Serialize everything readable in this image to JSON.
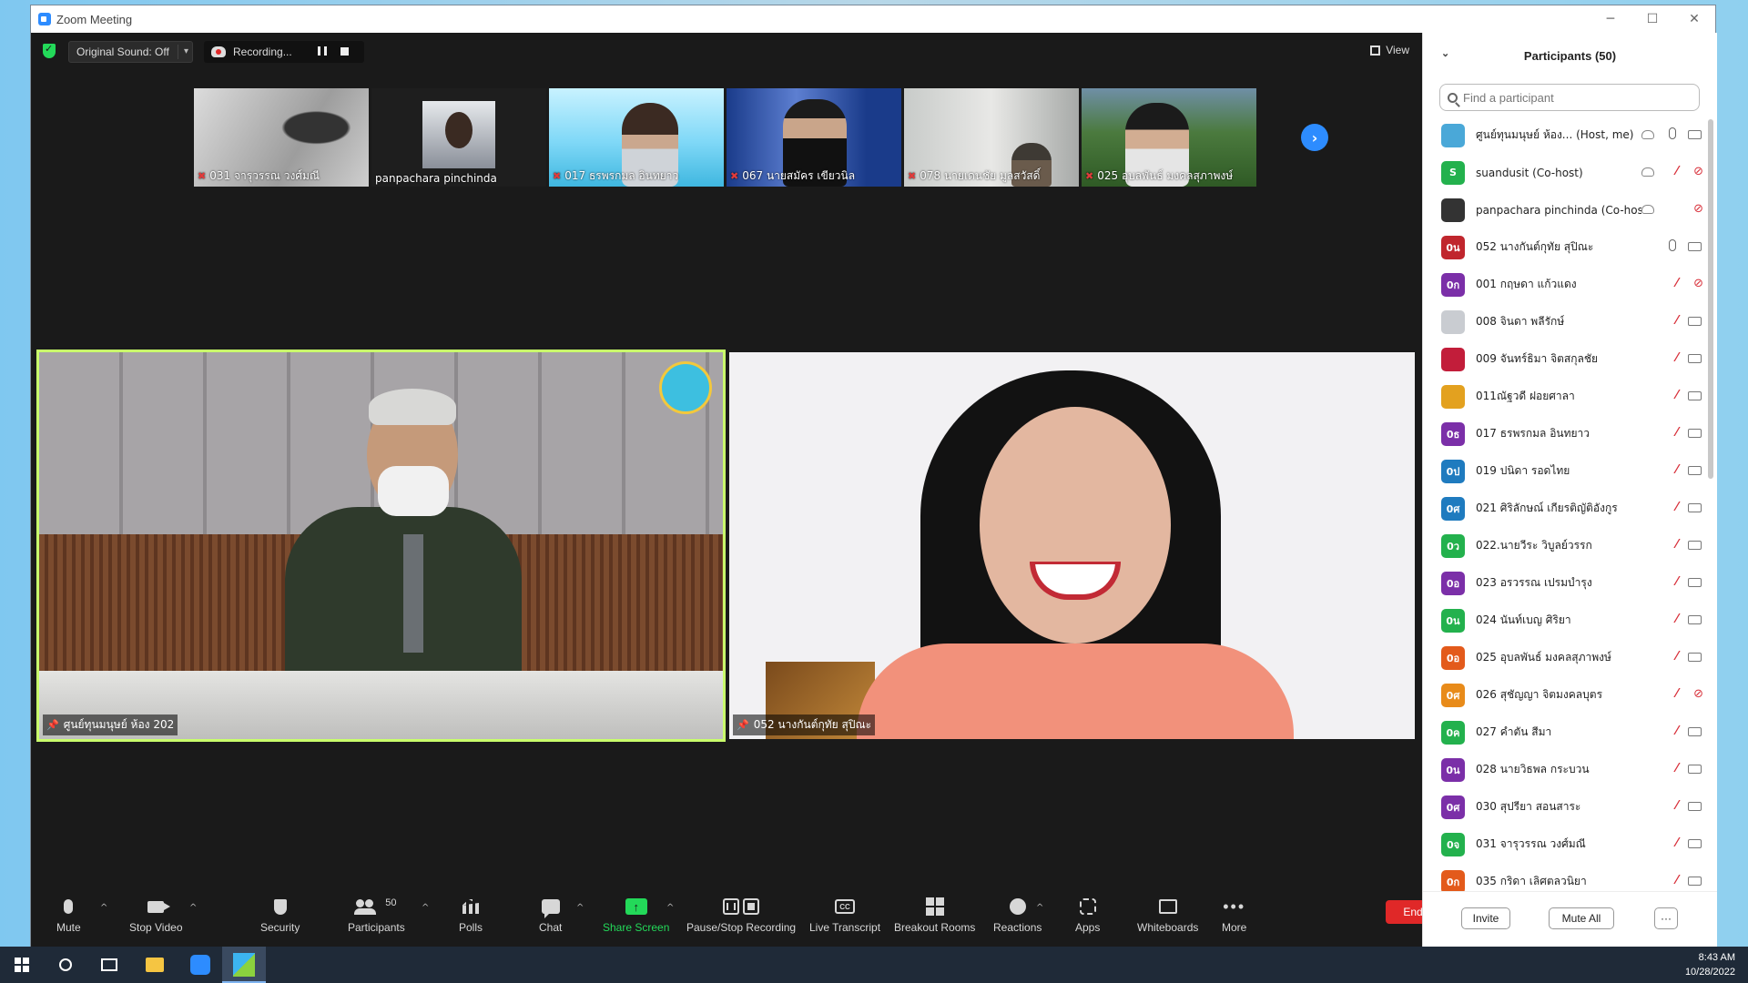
{
  "window": {
    "title": "Zoom Meeting",
    "controls": [
      "─",
      "☐",
      "✕"
    ]
  },
  "topbar": {
    "original_sound": "Original Sound: Off",
    "recording": "Recording...",
    "view": "View"
  },
  "thumbnails": [
    {
      "name": "031 จารุวรรณ  วงศ์มณี",
      "muted": true
    },
    {
      "name": "panpachara pinchinda",
      "muted": false
    },
    {
      "name": "017 ธรพรกมล อินทยาว",
      "muted": true
    },
    {
      "name": "067 นายสมัคร  เขียวนิล",
      "muted": true
    },
    {
      "name": "078 นายเดนชัย  มูลสวัสดิ์",
      "muted": true
    },
    {
      "name": "025 อุบลพันธ์ มงคลสุภาพงษ์",
      "muted": true
    }
  ],
  "main_videos": [
    {
      "name": "ศูนย์ทุนมนุษย์ ห้อง 202"
    },
    {
      "name": "052 นางกันต์กุทัย  สุปิณะ"
    }
  ],
  "toolbar": {
    "mute": "Mute",
    "stop_video": "Stop Video",
    "security": "Security",
    "participants": "Participants",
    "participants_count": "50",
    "polls": "Polls",
    "chat": "Chat",
    "share_screen": "Share Screen",
    "pause_stop_recording": "Pause/Stop Recording",
    "live_transcript": "Live Transcript",
    "breakout_rooms": "Breakout Rooms",
    "reactions": "Reactions",
    "apps": "Apps",
    "whiteboards": "Whiteboards",
    "more": "More",
    "end": "End",
    "cc": "CC",
    "share_arrow": "↑",
    "caret": "^",
    "more_glyph": "•••"
  },
  "panel": {
    "title": "Participants (50)",
    "search_placeholder": "Find a participant",
    "invite": "Invite",
    "mute_all": "Mute All",
    "more": "···",
    "participants": [
      {
        "avatar": "",
        "color": "#4aa8d8",
        "name": "ศูนย์ทุนมนุษย์ ห้อง... (Host, me)",
        "mic": "on",
        "cam": "on",
        "share": true
      },
      {
        "avatar": "S",
        "color": "#23b14d",
        "name": "suandusit (Co-host)",
        "mic": "off",
        "cam": "off",
        "share": true
      },
      {
        "avatar": "",
        "color": "#333333",
        "name": "panpachara pinchinda (Co-host)",
        "mic": "none",
        "cam": "off",
        "share": true
      },
      {
        "avatar": "0น",
        "color": "#c0262d",
        "name": "052 นางกันต์กุทัย  สุปิณะ",
        "mic": "on",
        "cam": "on",
        "share": false
      },
      {
        "avatar": "0ก",
        "color": "#7b2fa8",
        "name": "001 กฤษดา  แก้วแดง",
        "mic": "off",
        "cam": "off",
        "share": false
      },
      {
        "avatar": "",
        "color": "#c9ccd1",
        "name": "008 จินดา  พลีรักษ์",
        "mic": "off",
        "cam": "on",
        "share": false
      },
      {
        "avatar": "",
        "color": "#c21d3a",
        "name": "009 จันทร์ธิมา  จิตสกุลชัย",
        "mic": "off",
        "cam": "on",
        "share": false
      },
      {
        "avatar": "",
        "color": "#e3a11f",
        "name": "011ณัฐวดี ฝอยศาลา",
        "mic": "off",
        "cam": "on",
        "share": false
      },
      {
        "avatar": "0ธ",
        "color": "#7b2fa8",
        "name": "017 ธรพรกมล อินทยาว",
        "mic": "off",
        "cam": "on",
        "share": false
      },
      {
        "avatar": "0ป",
        "color": "#1f7bbf",
        "name": "019 ปนิดา รอดไทย",
        "mic": "off",
        "cam": "on",
        "share": false
      },
      {
        "avatar": "0ศ",
        "color": "#1f7bbf",
        "name": "021 ศิริลักษณ์ เกียรติญัติอังกูร",
        "mic": "off",
        "cam": "on",
        "share": false
      },
      {
        "avatar": "0ว",
        "color": "#23b14d",
        "name": "022.นายวีระ  วิบูลย์วรรก",
        "mic": "off",
        "cam": "on",
        "share": false
      },
      {
        "avatar": "0อ",
        "color": "#7b2fa8",
        "name": "023 อรวรรณ  เปรมบำรุง",
        "mic": "off",
        "cam": "on",
        "share": false
      },
      {
        "avatar": "0น",
        "color": "#23b14d",
        "name": "024 นันท์เบญ  ศิริยา",
        "mic": "off",
        "cam": "on",
        "share": false
      },
      {
        "avatar": "0อ",
        "color": "#e35a1b",
        "name": "025 อุบลพันธ์ มงคลสุภาพงษ์",
        "mic": "off",
        "cam": "on",
        "share": false
      },
      {
        "avatar": "0ศ",
        "color": "#e88b1a",
        "name": "026 สุชัญญา จิตมงคลบุตร",
        "mic": "off",
        "cam": "off",
        "share": false
      },
      {
        "avatar": "0ค",
        "color": "#23b14d",
        "name": "027 คำตัน สีมา",
        "mic": "off",
        "cam": "on",
        "share": false
      },
      {
        "avatar": "0น",
        "color": "#7b2fa8",
        "name": "028 นายวิธพล  กระบวน",
        "mic": "off",
        "cam": "on",
        "share": false
      },
      {
        "avatar": "0ศ",
        "color": "#7b2fa8",
        "name": "030 สุปรียา สอนสาระ",
        "mic": "off",
        "cam": "on",
        "share": false
      },
      {
        "avatar": "0จ",
        "color": "#23b14d",
        "name": "031 จารุวรรณ  วงศ์มณี",
        "mic": "off",
        "cam": "on",
        "share": false
      },
      {
        "avatar": "0ก",
        "color": "#e35a1b",
        "name": "035 กริดา เลิศตลวนิยา",
        "mic": "off",
        "cam": "on",
        "share": false
      }
    ]
  },
  "taskbar": {
    "time": "8:43 AM",
    "date": "10/28/2022"
  }
}
